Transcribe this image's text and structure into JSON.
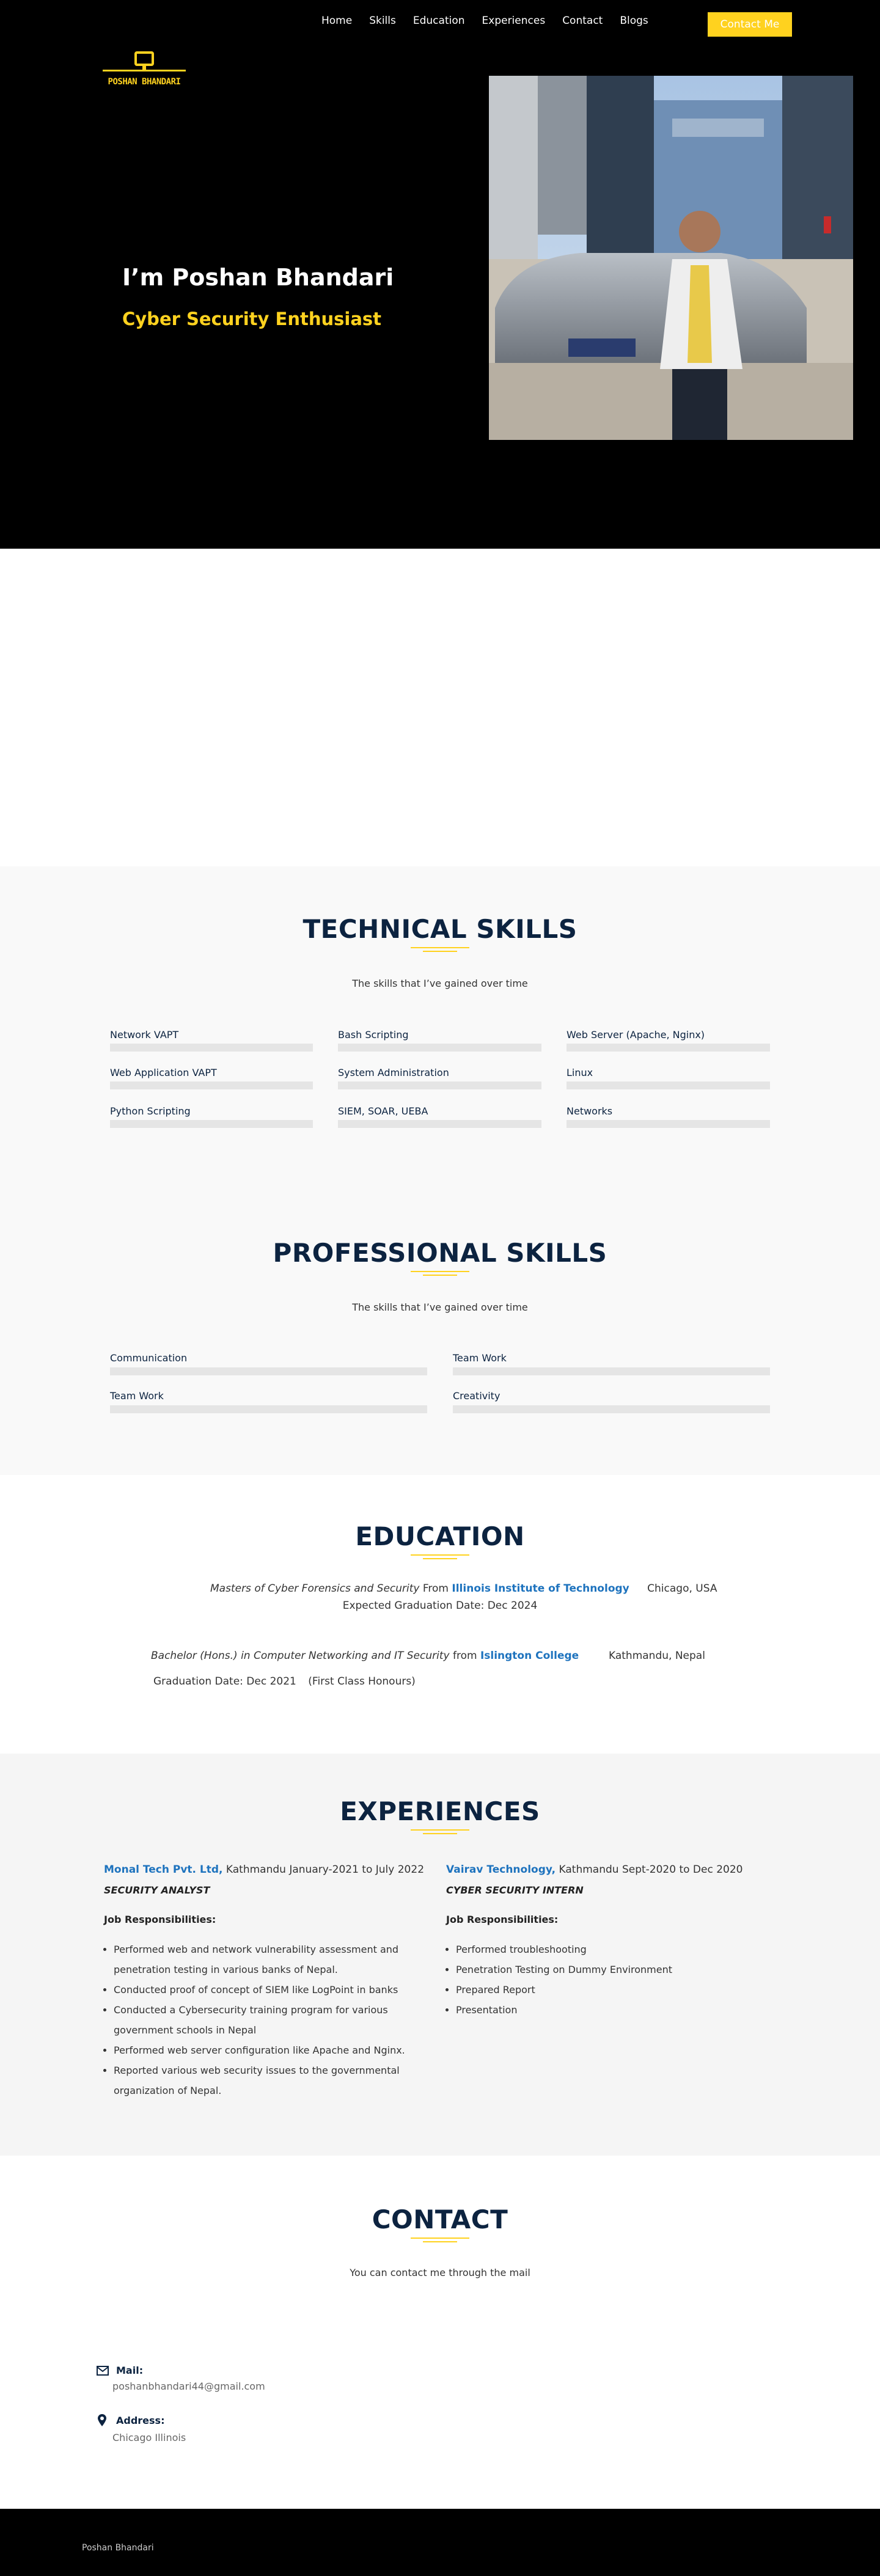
{
  "nav": {
    "items": [
      "Home",
      "Skills",
      "Education",
      "Experiences",
      "Contact",
      "Blogs"
    ],
    "contact_button": "Contact Me"
  },
  "logo": {
    "text": "POSHAN BHANDARI",
    "icon": "monitor-icon"
  },
  "hero": {
    "title": "I’m Poshan Bhandari",
    "subtitle": "Cyber Security Enthusiast",
    "photo": "portrait-photo"
  },
  "technical_skills": {
    "title": "TECHNICAL SKILLS",
    "subtitle": "The skills that I’ve gained over time",
    "items": [
      "Network VAPT",
      "Bash Scripting",
      "Web Server (Apache, Nginx)",
      "Web Application VAPT",
      "System Administration",
      "Linux",
      "Python Scripting",
      "SIEM, SOAR, UEBA",
      "Networks"
    ]
  },
  "professional_skills": {
    "title": "PROFESSIONAL SKILLS",
    "subtitle": "The skills that I’ve gained over time",
    "items": [
      "Communication",
      "Team Work",
      "Team Work",
      "Creativity"
    ]
  },
  "education": {
    "title": "EDUCATION",
    "entries": [
      {
        "degree": "Masters of Cyber Forensics and Security",
        "from": "From",
        "school": "Illinois Institute of Technology",
        "location": "Chicago, USA",
        "date": "Expected Graduation Date: Dec 2024"
      },
      {
        "degree": "Bachelor (Hons.) in Computer Networking and IT Security",
        "from": "from",
        "school": "Islington College",
        "location": "Kathmandu, Nepal",
        "date": "Graduation Date: Dec 2021",
        "note": "(First Class Honours)"
      }
    ]
  },
  "experiences": {
    "title": "EXPERIENCES",
    "responsibilities_label": "Job Responsibilities:",
    "jobs": [
      {
        "company": "Monal Tech Pvt. Ltd,",
        "meta": " Kathmandu  January-2021 to July 2022",
        "role": "SECURITY ANALYST",
        "items": [
          "Performed web and network vulnerability assessment and penetration testing in various banks of Nepal.",
          "Conducted proof of concept of SIEM like LogPoint in banks",
          "Conducted a Cybersecurity training program for various government schools in Nepal",
          "Performed web server configuration like Apache and Nginx.",
          "Reported various web security issues to the governmental organization of Nepal."
        ]
      },
      {
        "company": "Vairav Technology,",
        "meta": " Kathmandu  Sept-2020 to Dec 2020",
        "role": "CYBER SECURITY INTERN",
        "items": [
          "Performed troubleshooting",
          "Penetration Testing on Dummy Environment",
          "Prepared Report",
          "Presentation"
        ]
      }
    ]
  },
  "contact": {
    "title": "CONTACT",
    "subtitle": "You can contact me through the mail",
    "mail_label": "Mail:",
    "mail_value": "poshanbhandari44@gmail.com",
    "address_label": "Address:",
    "address_value": "Chicago Illinois"
  },
  "footer": {
    "text": "Poshan Bhandari"
  },
  "colors": {
    "accent": "#ffd21f",
    "navy": "#0c2340",
    "link": "#1e73be"
  }
}
